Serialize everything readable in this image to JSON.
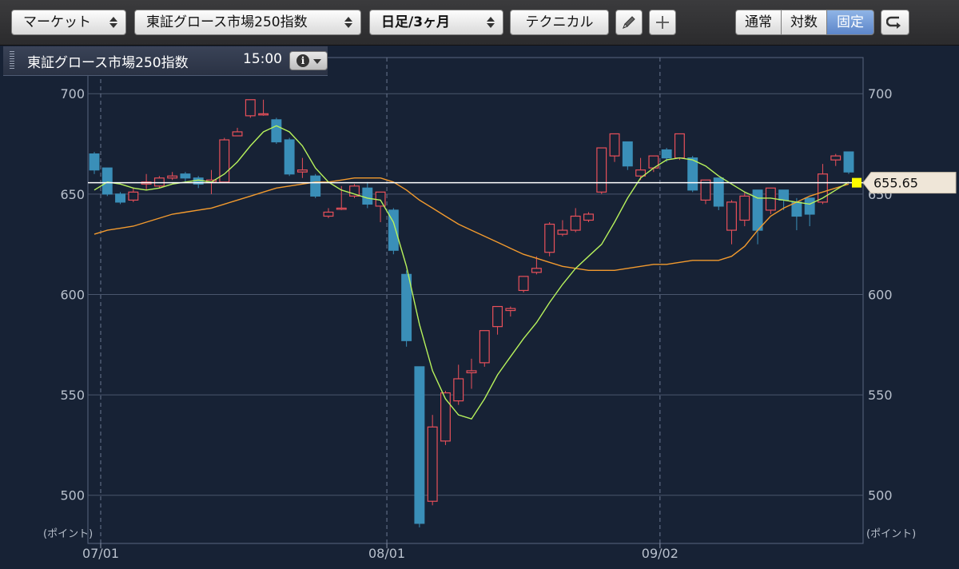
{
  "toolbar": {
    "market_label": "マーケット",
    "index_label": "東証グロース市場250指数",
    "period_label": "日足/3ヶ月",
    "technical_label": "テクニカル",
    "draw_icon": "pencil-icon",
    "add_icon": "plus-icon",
    "scale_modes": [
      "通常",
      "対数",
      "固定"
    ],
    "active_scale": "固定",
    "undo_icon": "undo-icon"
  },
  "info": {
    "title": "東証グロース市場250指数",
    "time": "15:00",
    "info_icon": "info-icon"
  },
  "colors": {
    "up": "#e9505a",
    "down": "#3a8fb8",
    "ma_short": "#b7f25c",
    "ma_long": "#f29a2e",
    "price_line": "#ffffff",
    "price_marker": "#ffff00"
  },
  "chart_data": {
    "type": "candlestick",
    "ylabel": "(ポイント)",
    "ylim": [
      476,
      718
    ],
    "yticks": [
      500,
      550,
      600,
      650,
      700
    ],
    "date_labels": [
      {
        "label": "07/01",
        "index": 0
      },
      {
        "label": "08/01",
        "index": 22
      },
      {
        "label": "09/02",
        "index": 43
      }
    ],
    "last_price": "655.65",
    "last_price_value": 655.65,
    "candles": [
      [
        670,
        671,
        660,
        662
      ],
      [
        663,
        663,
        649,
        650
      ],
      [
        650,
        651,
        645,
        646
      ],
      [
        647,
        653,
        646,
        651
      ],
      [
        655,
        660,
        652,
        656
      ],
      [
        654,
        659,
        653,
        658
      ],
      [
        658,
        661,
        657,
        659
      ],
      [
        660,
        661,
        656,
        658
      ],
      [
        658,
        659,
        653,
        655
      ],
      [
        656,
        662,
        650,
        657
      ],
      [
        656,
        678,
        656,
        677
      ],
      [
        679,
        683,
        679,
        681
      ],
      [
        689,
        697,
        688,
        697
      ],
      [
        690,
        697,
        689,
        690
      ],
      [
        687,
        688,
        675,
        676
      ],
      [
        677,
        678,
        659,
        660
      ],
      [
        661,
        668,
        658,
        662
      ],
      [
        659,
        660,
        648,
        649
      ],
      [
        639,
        643,
        638,
        641
      ],
      [
        643,
        654,
        642,
        643
      ],
      [
        649,
        655,
        648,
        654
      ],
      [
        653,
        656,
        643,
        645
      ],
      [
        644,
        648,
        636,
        651
      ],
      [
        642,
        643,
        620,
        622
      ],
      [
        610,
        612,
        574,
        577
      ],
      [
        564,
        564,
        484,
        486
      ],
      [
        497,
        540,
        495,
        534
      ],
      [
        527,
        552,
        525,
        551
      ],
      [
        547,
        565,
        545,
        558
      ],
      [
        561,
        568,
        553,
        562
      ],
      [
        566,
        582,
        564,
        582
      ],
      [
        584,
        594,
        580,
        594
      ],
      [
        592,
        594,
        589,
        593
      ],
      [
        602,
        609,
        601,
        609
      ],
      [
        611,
        619,
        610,
        613
      ],
      [
        621,
        636,
        619,
        635
      ],
      [
        630,
        637,
        629,
        632
      ],
      [
        632,
        643,
        631,
        639
      ],
      [
        637,
        641,
        636,
        640
      ],
      [
        651,
        673,
        650,
        673
      ],
      [
        669,
        680,
        666,
        680
      ],
      [
        676,
        676,
        662,
        664
      ],
      [
        659,
        668,
        657,
        662
      ],
      [
        663,
        669,
        661,
        669
      ],
      [
        672,
        673,
        666,
        668
      ],
      [
        668,
        680,
        667,
        680
      ],
      [
        668,
        669,
        651,
        652
      ],
      [
        647,
        657,
        645,
        657
      ],
      [
        658,
        658,
        642,
        644
      ],
      [
        632,
        647,
        625,
        646
      ],
      [
        637,
        651,
        634,
        649
      ],
      [
        652,
        652,
        625,
        632
      ],
      [
        642,
        653,
        640,
        653
      ],
      [
        652,
        652,
        642,
        647
      ],
      [
        646,
        648,
        632,
        639
      ],
      [
        648,
        648,
        634,
        640
      ],
      [
        646,
        665,
        645,
        660
      ],
      [
        667,
        670,
        664,
        669
      ],
      [
        671,
        671,
        660,
        661
      ]
    ],
    "ma_short": [
      652,
      656,
      655,
      653,
      652,
      653,
      655,
      656,
      657,
      656,
      660,
      666,
      674,
      681,
      684,
      681,
      674,
      663,
      656,
      652,
      650,
      648,
      647,
      636,
      614,
      585,
      562,
      548,
      540,
      538,
      548,
      560,
      569,
      578,
      586,
      596,
      605,
      613,
      619,
      625,
      636,
      648,
      658,
      663,
      667,
      668,
      667,
      664,
      659,
      655,
      651,
      648,
      648,
      647,
      646,
      645,
      648,
      652,
      656
    ],
    "ma_long": [
      630,
      632,
      633,
      634,
      636,
      638,
      640,
      641,
      642,
      643,
      645,
      647,
      649,
      651,
      653,
      654,
      655,
      656,
      656,
      657,
      658,
      658,
      658,
      656,
      652,
      647,
      643,
      639,
      635,
      632,
      629,
      626,
      623,
      620,
      618,
      616,
      614,
      613,
      612,
      612,
      612,
      613,
      614,
      615,
      615,
      616,
      617,
      617,
      617,
      619,
      624,
      632,
      639,
      643,
      646,
      649,
      651,
      653,
      655
    ]
  }
}
